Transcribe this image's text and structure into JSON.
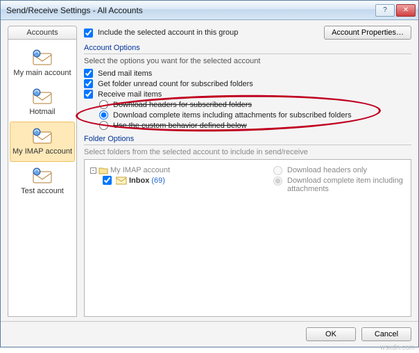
{
  "window": {
    "title": "Send/Receive Settings - All Accounts"
  },
  "topbar": {
    "include_label": "Include the selected account in this group",
    "include_checked": true,
    "properties_btn": "Account Properties…"
  },
  "sidebar": {
    "tab": "Accounts",
    "items": [
      {
        "label": "My main account",
        "selected": false
      },
      {
        "label": "Hotmail",
        "selected": false
      },
      {
        "label": "My IMAP account",
        "selected": true
      },
      {
        "label": "Test account",
        "selected": false
      }
    ]
  },
  "account_options": {
    "title": "Account Options",
    "desc": "Select the options you want for the selected account",
    "send_mail": {
      "label": "Send mail items",
      "checked": true
    },
    "unread_count": {
      "label": "Get folder unread count for subscribed folders",
      "checked": true
    },
    "receive": {
      "label": "Receive mail items",
      "checked": true
    },
    "radios": {
      "headers": {
        "label": "Download headers for subscribed folders",
        "selected": false,
        "struck": true
      },
      "complete": {
        "label": "Download complete items including attachments for subscribed folders",
        "selected": true,
        "circled": true
      },
      "custom": {
        "label": "Use the custom behavior defined below",
        "selected": false,
        "struck": true
      }
    }
  },
  "folder_options": {
    "title": "Folder Options",
    "desc": "Select folders from the selected account to include in send/receive",
    "tree": {
      "root": "My IMAP account",
      "inbox_label": "Inbox",
      "inbox_count": "(69)",
      "inbox_checked": true
    },
    "radios": {
      "headers": {
        "label": "Download headers only",
        "selected": false
      },
      "complete": {
        "label": "Download complete item including attachments",
        "selected": true
      }
    },
    "disabled": true
  },
  "buttons": {
    "ok": "OK",
    "cancel": "Cancel"
  },
  "watermark": "wsxdn.com"
}
